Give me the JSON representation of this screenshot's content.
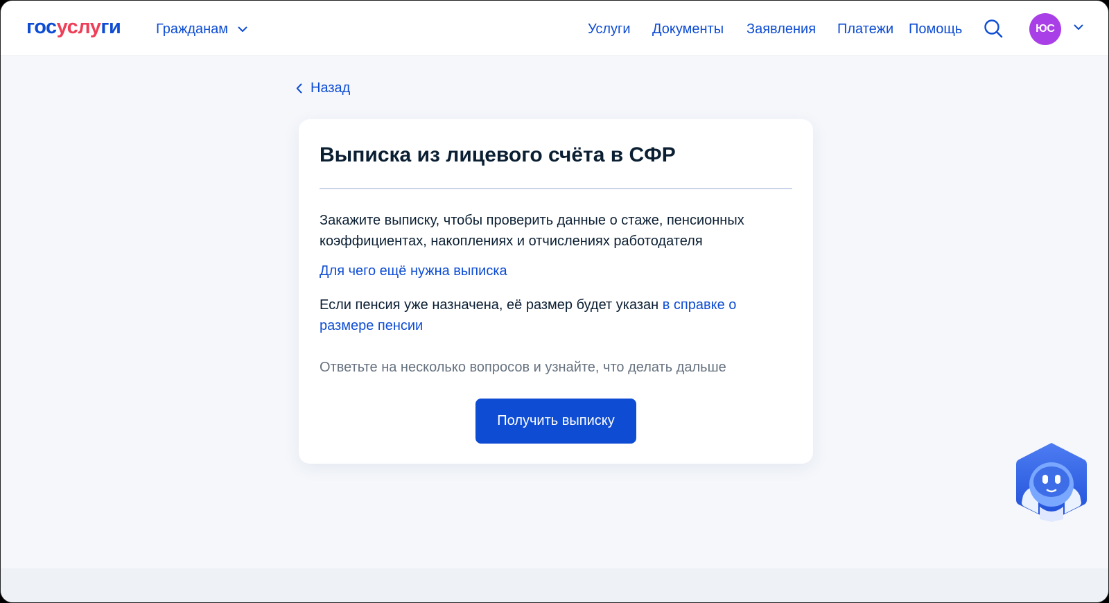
{
  "header": {
    "logo": {
      "part1": "гос",
      "part2": "услу",
      "part3": "ги"
    },
    "audience_label": "Гражданам",
    "nav": [
      {
        "label": "Услуги"
      },
      {
        "label": "Документы"
      },
      {
        "label": "Заявления"
      },
      {
        "label": "Платежи"
      },
      {
        "label": "Помощь"
      }
    ],
    "avatar_initials": "ЮС"
  },
  "back_label": "Назад",
  "card": {
    "title": "Выписка из лицевого счёта в СФР",
    "description": "Закажите выписку, чтобы проверить данные о стаже, пенсионных коэффициентах, накоплениях и отчислениях работодателя",
    "why_link": "Для чего ещё нужна выписка",
    "pension_text": "Если пенсия уже назначена, её размер будет указан ",
    "pension_link": "в справке о размере пенсии",
    "hint": "Ответьте на несколько вопросов и узнайте, что делать дальше",
    "button_label": "Получить выписку"
  },
  "colors": {
    "brand_blue": "#0d4cd3",
    "brand_red": "#ee3f58",
    "avatar_purple": "#a93fe6",
    "page_bg": "#f5f7fb",
    "text_dark": "#0b1f33",
    "text_muted": "#66727f"
  },
  "icons": [
    "chevron-down-icon",
    "search-icon",
    "chevron-left-icon",
    "robot-assistant-icon"
  ]
}
